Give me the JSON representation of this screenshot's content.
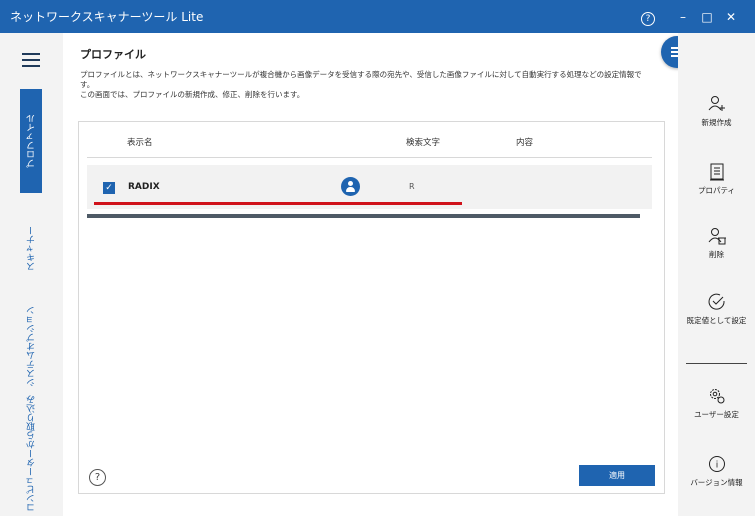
{
  "window": {
    "title": "ネットワークスキャナーツール Lite",
    "help_glyph": "?",
    "minimize_glyph": "–",
    "maximize_glyph": "□",
    "close_glyph": "✕"
  },
  "left_nav": {
    "items": [
      {
        "label": "プロファイル",
        "active": true
      },
      {
        "label": "スキャナー",
        "active": false
      },
      {
        "label": "システムオプション",
        "active": false
      },
      {
        "label": "コンピューターから取り込み",
        "active": false
      }
    ]
  },
  "page": {
    "title": "プロファイル",
    "description_line1": "プロファイルとは、ネットワークスキャナーツールが複合機から画像データを受信する際の宛先や、受信した画像ファイルに対して自動実行する処理などの設定情報で",
    "description_line2": "す。",
    "description_line3": "この画面では、プロファイルの新規作成、修正、削除を行います。"
  },
  "table": {
    "columns": [
      "表示名",
      "検索文字",
      "内容"
    ],
    "rows": [
      {
        "checked": true,
        "check_glyph": "✓",
        "name": "RADIX",
        "keyword": "R",
        "content": ""
      }
    ]
  },
  "footer": {
    "help_glyph": "?",
    "apply_label": "適用"
  },
  "right_actions": {
    "new": "新規作成",
    "properties": "プロパティ",
    "delete": "削除",
    "set_default": "既定値として設定",
    "user_settings": "ユーザー設定",
    "version_info": "バージョン情報",
    "info_glyph": "i"
  },
  "colors": {
    "accent": "#1f64b0",
    "highlight_line": "#d0121b"
  }
}
